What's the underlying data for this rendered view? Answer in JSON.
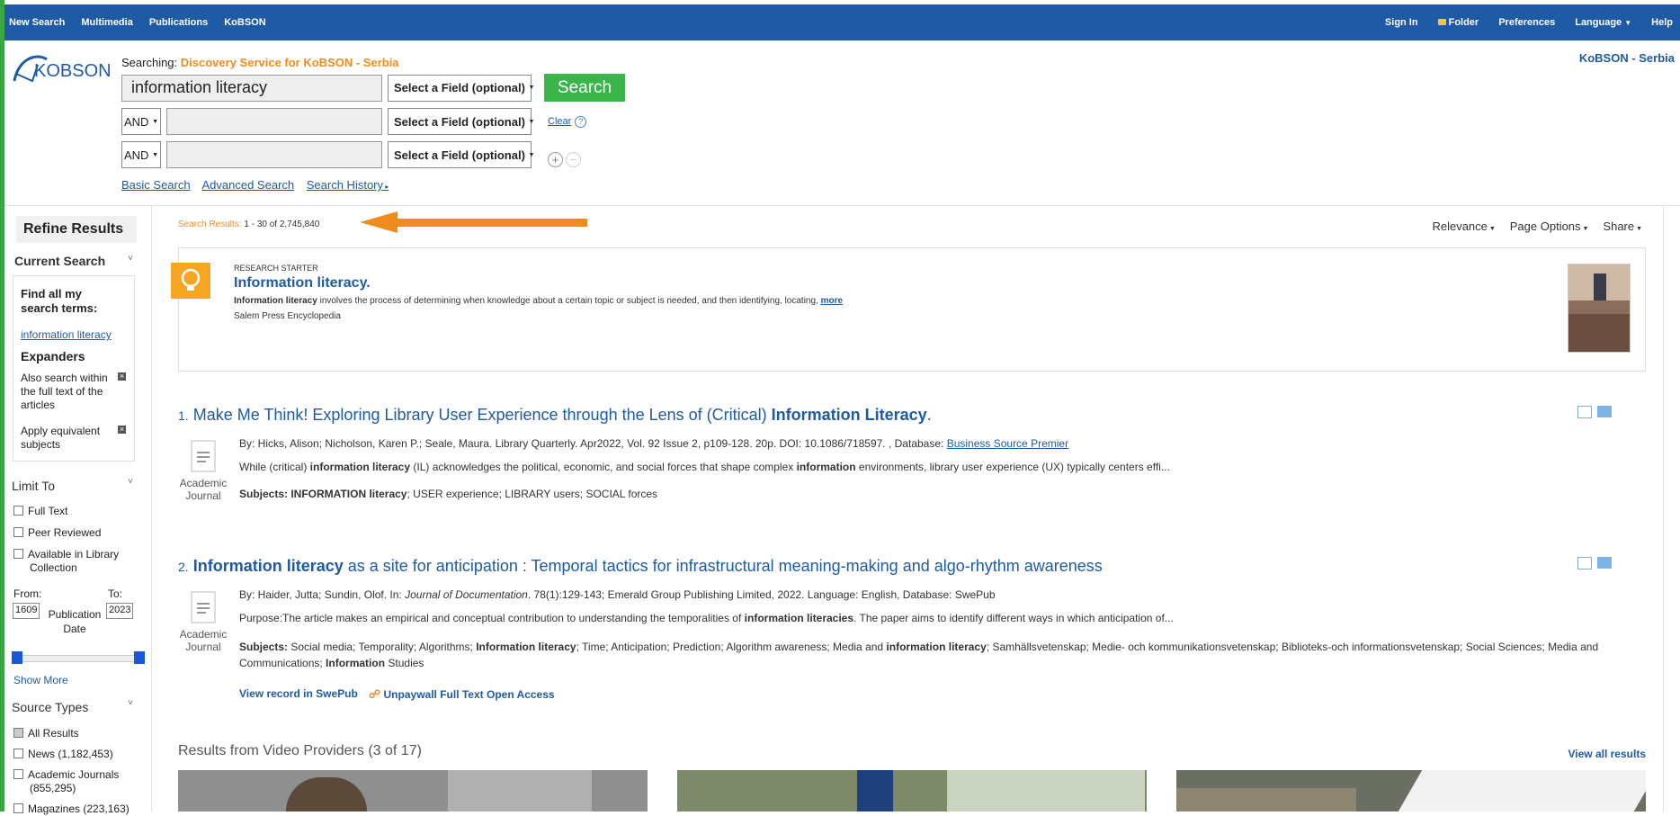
{
  "topnav": {
    "left": [
      "New Search",
      "Multimedia",
      "Publications",
      "KoBSON"
    ],
    "sign_in": "Sign In",
    "folder": "Folder",
    "preferences": "Preferences",
    "language": "Language",
    "help": "Help"
  },
  "brand": {
    "logo_text": "KOBSON",
    "right_label": "KoBSON - Serbia"
  },
  "search": {
    "searching_label": "Searching:",
    "service": "Discovery Service for KoBSON - Serbia",
    "query": "information literacy",
    "field_select": "Select a Field (optional)",
    "bool_op": "AND",
    "button": "Search",
    "clear": "Clear",
    "links": [
      "Basic Search",
      "Advanced Search",
      "Search History"
    ]
  },
  "sidebar": {
    "refine": "Refine Results",
    "current_search": "Current Search",
    "find_all": "Find all my search terms:",
    "term": "information literacy",
    "expanders": "Expanders",
    "expander_items": [
      "Also search within the full text of the articles",
      "Apply equivalent subjects"
    ],
    "limit_to": "Limit To",
    "limit_items": [
      "Full Text",
      "Peer Reviewed",
      "Available in Library Collection"
    ],
    "from_label": "From:",
    "to_label": "To:",
    "from_value": "1609",
    "to_value": "2023",
    "pub_date_label": "Publication Date",
    "slider_range": [
      0,
      1
    ],
    "show_more": "Show More",
    "source_types": "Source Types",
    "source_items": [
      "All Results",
      "News (1,182,453)",
      "Academic Journals (855,295)",
      "Magazines (223,163)"
    ]
  },
  "results": {
    "label": "Search Results:",
    "range": "1 - 30 of 2,745,840",
    "sort": [
      "Relevance",
      "Page Options",
      "Share"
    ],
    "research_starter": {
      "label": "RESEARCH STARTER",
      "title": "Information literacy.",
      "snippet_bold": "Information literacy",
      "snippet": " involves the process of determining when knowledge about a certain topic or subject is needed, and then identifying, locating, ",
      "more": "more",
      "source": "Salem Press Encyclopedia"
    },
    "items": [
      {
        "num": "1.",
        "title_a": "Make Me Think! Exploring Library User Experience through the Lens of (Critical) ",
        "title_b": "Information Literacy",
        "title_c": ".",
        "byline": "By: Hicks, Alison; Nicholson, Karen P.; Seale, Maura. Library Quarterly. Apr2022, Vol. 92 Issue 2, p109-128. 20p. DOI: 10.1086/718597. , Database: ",
        "database": "Business Source Premier",
        "snippet_a": "While (critical) ",
        "snippet_b": "information literacy",
        "snippet_c": " (IL) acknowledges the political, economic, and social forces that shape complex ",
        "snippet_d": "information",
        "snippet_e": " environments, library user experience (UX) typically centers effi...",
        "subjects_label": "Subjects:",
        "subjects_b": " INFORMATION literacy",
        "subjects_rest": "; USER experience; LIBRARY users; SOCIAL forces",
        "doctype": "Academic Journal"
      },
      {
        "num": "2.",
        "title_b": "Information literacy",
        "title_c": " as a site for anticipation : Temporal tactics for infrastructural meaning-making and algo-rhythm awareness",
        "byline_a": "By: Haider, Jutta; Sundin, Olof. In: ",
        "journal": "Journal of Documentation",
        "byline_b": ". 78(1):129-143; Emerald Group Publishing Limited, 2022. Language: English, Database: SwePub",
        "snippet_a": "Purpose:The article makes an empirical and conceptual contribution to understanding the temporalities of ",
        "snippet_b": "information literacies",
        "snippet_c": ". The paper aims to identify different ways in which anticipation of...",
        "subjects_label": "Subjects:",
        "subjects_1": " Social media; Temporality; Algorithms; ",
        "subjects_2": "Information literacy",
        "subjects_3": "; Time; Anticipation; Prediction; Algorithm awareness; Media and ",
        "subjects_4": "information literacy",
        "subjects_5": "; Samhällsvetenskap; Medie- och kommunikationsvetenskap; Biblioteks-och informationsvetenskap; Social Sciences; Media and Communications; ",
        "subjects_6": "Information",
        "subjects_7": " Studies",
        "link1": "View record in SwePub",
        "link2": "Unpaywall Full Text Open Access",
        "doctype": "Academic Journal"
      }
    ],
    "video_header": "Results from Video Providers (3 of 17)",
    "view_all": "View all results"
  },
  "colors": {
    "topbar": "#1f5aa6",
    "accent_orange": "#f08c1e",
    "search_green": "#3ab54a",
    "link": "#1f5aa6"
  }
}
